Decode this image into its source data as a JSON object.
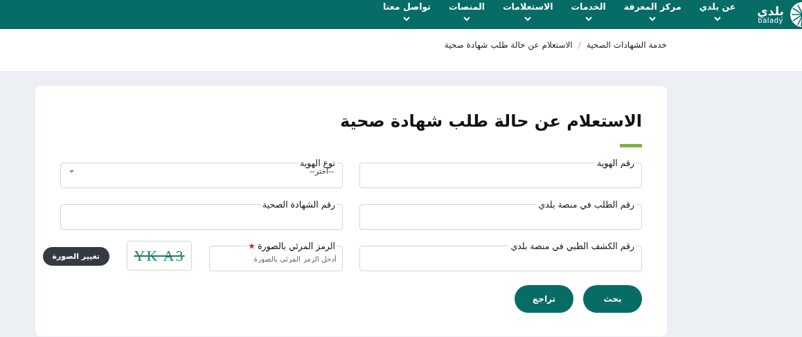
{
  "nav": {
    "logo": {
      "arabic": "بلدي",
      "latin": "balady"
    },
    "items": [
      {
        "label": "عن بلدي"
      },
      {
        "label": "مركز المعرفة"
      },
      {
        "label": "الخدمات"
      },
      {
        "label": "الاستعلامات"
      },
      {
        "label": "المنصات"
      },
      {
        "label": "تواصل معنا"
      }
    ]
  },
  "breadcrumb": {
    "items": [
      "خدمة الشهادات الصحية",
      "الاستعلام عن حالة طلب شهادة صحية"
    ],
    "separator": "/"
  },
  "form": {
    "title": "الاستعلام عن حالة طلب شهادة صحية",
    "fields": [
      {
        "kind": "text",
        "label": "رقم الهوية"
      },
      {
        "kind": "select",
        "label": "نوع الهوية",
        "value": "--اختر--"
      },
      {
        "kind": "text",
        "label": "رقم الطلب في منصة بلدي"
      },
      {
        "kind": "text",
        "label": "رقم الشهادة الصحية"
      },
      {
        "kind": "text",
        "label": "رقم الكشف الطبي في منصة بلدي"
      },
      {
        "kind": "captcha",
        "label": "الرمز المرئي بالصورة",
        "required": true,
        "placeholder": "أدخل الرمز المرئي بالصورة",
        "captcha_text": "YK A3",
        "refresh_button": "تغيير الصورة"
      }
    ],
    "buttons": [
      "بحث",
      "تراجع"
    ]
  }
}
